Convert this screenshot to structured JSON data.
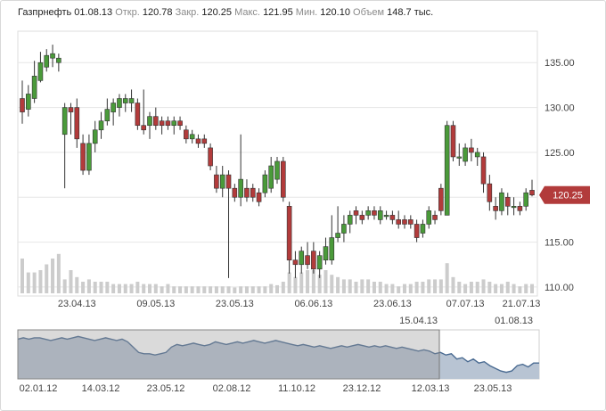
{
  "header": {
    "ticker": "Газпрнефть",
    "date": "01.08.13",
    "open_label": "Откр.",
    "open": "120.78",
    "close_label": "Закр.",
    "close": "120.25",
    "high_label": "Макс.",
    "high": "121.95",
    "low_label": "Мин.",
    "low": "120.10",
    "volume_label": "Объем",
    "volume": "148.7 тыс."
  },
  "colors": {
    "up": "#4a9a3a",
    "down": "#b23b3b",
    "grid": "#e6e6e6",
    "volume": "#cccccc",
    "price_tag": "#b23b3b",
    "nav_fill": "#b8c4d3",
    "nav_line": "#4a6b92"
  },
  "chart_data": {
    "type": "candlestick",
    "title": "Газпрнефть",
    "ylim": [
      109,
      138.5
    ],
    "yticks": [
      "135.00",
      "130.00",
      "125.00",
      "120.00",
      "115.00",
      "110.00"
    ],
    "xticks": [
      "23.04.13",
      "09.05.13",
      "23.05.13",
      "06.06.13",
      "23.06.13",
      "07.07.13",
      "21.07.13"
    ],
    "current_price": "120.25",
    "candles": [
      [
        131.0,
        129.5,
        133.0,
        128.2
      ],
      [
        129.8,
        131.5,
        132.5,
        129.0
      ],
      [
        131.0,
        133.5,
        135.2,
        130.5
      ],
      [
        133.0,
        135.0,
        136.2,
        132.8
      ],
      [
        134.5,
        135.8,
        136.5,
        134.0
      ],
      [
        135.5,
        136.0,
        137.0,
        134.5
      ],
      [
        135.0,
        135.5,
        136.0,
        134.0
      ],
      [
        127.0,
        130.0,
        130.5,
        121.0
      ],
      [
        130.0,
        129.5,
        130.5,
        127.0
      ],
      [
        130.0,
        126.5,
        131.0,
        125.5
      ],
      [
        126.0,
        123.0,
        127.0,
        122.5
      ],
      [
        123.0,
        126.0,
        127.0,
        122.5
      ],
      [
        126.0,
        127.5,
        128.5,
        125.0
      ],
      [
        127.5,
        128.5,
        129.5,
        126.5
      ],
      [
        128.5,
        129.8,
        131.0,
        128.0
      ],
      [
        129.5,
        130.5,
        131.0,
        128.0
      ],
      [
        130.0,
        131.0,
        131.5,
        129.0
      ],
      [
        130.5,
        131.0,
        131.5,
        129.5
      ],
      [
        130.5,
        131.0,
        132.0,
        129.5
      ],
      [
        130.5,
        128.0,
        131.0,
        127.5
      ],
      [
        128.0,
        127.5,
        132.0,
        127.0
      ],
      [
        128.0,
        129.0,
        129.5,
        126.5
      ],
      [
        129.0,
        128.0,
        130.0,
        127.5
      ],
      [
        128.5,
        128.0,
        129.0,
        127.0
      ],
      [
        128.5,
        128.0,
        129.0,
        127.5
      ],
      [
        128.0,
        128.5,
        129.0,
        127.0
      ],
      [
        128.5,
        128.0,
        129.0,
        127.5
      ],
      [
        127.5,
        126.5,
        128.0,
        126.0
      ],
      [
        126.5,
        127.0,
        127.5,
        126.0
      ],
      [
        126.5,
        126.0,
        127.0,
        125.5
      ],
      [
        126.5,
        126.0,
        127.0,
        125.5
      ],
      [
        125.5,
        123.5,
        126.0,
        123.0
      ],
      [
        122.5,
        121.0,
        123.5,
        120.5
      ],
      [
        121.0,
        122.5,
        123.5,
        120.0
      ],
      [
        122.5,
        121.0,
        123.0,
        111.0
      ],
      [
        121.0,
        120.0,
        121.5,
        119.5
      ],
      [
        120.0,
        122.0,
        127.0,
        119.0
      ],
      [
        121.0,
        120.0,
        122.0,
        119.5
      ],
      [
        121.0,
        120.0,
        121.5,
        119.5
      ],
      [
        120.5,
        119.5,
        121.0,
        119.0
      ],
      [
        120.5,
        122.5,
        123.0,
        120.0
      ],
      [
        121.0,
        123.5,
        124.5,
        120.5
      ],
      [
        122.0,
        124.0,
        124.5,
        121.5
      ],
      [
        124.0,
        120.0,
        124.5,
        119.5
      ],
      [
        119.0,
        113.0,
        119.5,
        111.5
      ],
      [
        113.0,
        112.5,
        114.0,
        111.0
      ],
      [
        112.5,
        114.0,
        114.5,
        111.5
      ],
      [
        113.5,
        112.5,
        115.0,
        112.0
      ],
      [
        114.0,
        112.0,
        115.0,
        111.5
      ],
      [
        112.0,
        113.5,
        114.0,
        111.0
      ],
      [
        113.0,
        114.5,
        115.5,
        112.5
      ],
      [
        113.0,
        115.5,
        118.0,
        112.5
      ],
      [
        115.5,
        116.0,
        119.0,
        115.0
      ],
      [
        116.0,
        117.0,
        118.0,
        115.0
      ],
      [
        117.0,
        118.0,
        118.5,
        116.0
      ],
      [
        118.5,
        118.0,
        119.0,
        117.0
      ],
      [
        118.0,
        117.5,
        118.5,
        117.0
      ],
      [
        118.0,
        118.5,
        119.0,
        117.5
      ],
      [
        118.5,
        118.0,
        119.0,
        117.5
      ],
      [
        117.5,
        118.5,
        119.0,
        117.0
      ],
      [
        118.0,
        118.0,
        118.5,
        117.5
      ],
      [
        118.0,
        117.5,
        118.5,
        117.0
      ],
      [
        117.5,
        117.0,
        118.5,
        116.5
      ],
      [
        117.5,
        117.0,
        118.0,
        116.5
      ],
      [
        117.5,
        117.0,
        118.0,
        116.5
      ],
      [
        117.0,
        115.5,
        117.5,
        115.0
      ],
      [
        116.0,
        117.0,
        117.5,
        115.5
      ],
      [
        117.0,
        118.5,
        119.0,
        116.5
      ],
      [
        118.0,
        117.5,
        118.5,
        117.0
      ],
      [
        121.0,
        118.5,
        121.5,
        118.0
      ],
      [
        118.0,
        128.0,
        128.5,
        118.0
      ],
      [
        128.0,
        124.5,
        128.5,
        124.0
      ],
      [
        124.5,
        124.5,
        126.0,
        123.5
      ],
      [
        124.0,
        125.5,
        126.0,
        123.5
      ],
      [
        125.5,
        125.0,
        126.5,
        124.0
      ],
      [
        124.5,
        125.0,
        125.5,
        123.5
      ],
      [
        124.5,
        121.5,
        125.0,
        120.5
      ],
      [
        121.5,
        119.5,
        122.5,
        118.5
      ],
      [
        119.0,
        118.5,
        120.0,
        117.5
      ],
      [
        118.5,
        120.5,
        121.0,
        118.0
      ],
      [
        120.0,
        119.0,
        120.5,
        118.0
      ],
      [
        119.0,
        119.0,
        120.0,
        118.0
      ],
      [
        119.0,
        118.5,
        119.5,
        118.0
      ],
      [
        119.0,
        120.5,
        121.0,
        118.5
      ],
      [
        120.78,
        120.25,
        121.95,
        120.1
      ]
    ],
    "volumes": [
      0.3,
      0.18,
      0.18,
      0.2,
      0.25,
      0.3,
      0.34,
      0.12,
      0.2,
      0.14,
      0.1,
      0.12,
      0.1,
      0.1,
      0.1,
      0.08,
      0.08,
      0.08,
      0.08,
      0.1,
      0.08,
      0.08,
      0.08,
      0.06,
      0.08,
      0.06,
      0.06,
      0.06,
      0.06,
      0.06,
      0.06,
      0.06,
      0.06,
      0.06,
      0.06,
      0.05,
      0.06,
      0.06,
      0.06,
      0.06,
      0.06,
      0.08,
      0.07,
      0.1,
      0.18,
      0.14,
      0.18,
      0.2,
      0.2,
      0.16,
      0.2,
      0.16,
      0.14,
      0.12,
      0.12,
      0.1,
      0.12,
      0.12,
      0.1,
      0.1,
      0.08,
      0.08,
      0.06,
      0.08,
      0.08,
      0.1,
      0.1,
      0.12,
      0.12,
      0.12,
      0.26,
      0.14,
      0.1,
      0.08,
      0.1,
      0.1,
      0.12,
      0.1,
      0.08,
      0.08,
      0.1,
      0.08,
      0.06,
      0.08,
      0.08
    ]
  },
  "navigator": {
    "xticks": [
      "02.01.12",
      "14.03.12",
      "23.05.12",
      "02.08.12",
      "11.10.12",
      "23.12.12",
      "12.03.13",
      "23.05.13"
    ],
    "range_start_label": "15.04.13",
    "range_end_label": "01.08.13",
    "ylim": [
      108,
      145
    ],
    "series": [
      138,
      139,
      138,
      139,
      139,
      138,
      137,
      138,
      139,
      138,
      139,
      140,
      139,
      138,
      137,
      138,
      139,
      138,
      137,
      138,
      136,
      132,
      128,
      127,
      127,
      126,
      127,
      128,
      132,
      134,
      133,
      134,
      135,
      134,
      133,
      134,
      136,
      135,
      134,
      135,
      136,
      135,
      136,
      137,
      136,
      135,
      136,
      137,
      136,
      135,
      134,
      133,
      134,
      133,
      132,
      133,
      132,
      131,
      132,
      133,
      132,
      133,
      134,
      133,
      132,
      133,
      132,
      133,
      132,
      131,
      132,
      131,
      130,
      129,
      130,
      129,
      127,
      128,
      126,
      127,
      123,
      124,
      121,
      123,
      120,
      121,
      118,
      116,
      114,
      113,
      114,
      118,
      119,
      117,
      120,
      120
    ]
  }
}
